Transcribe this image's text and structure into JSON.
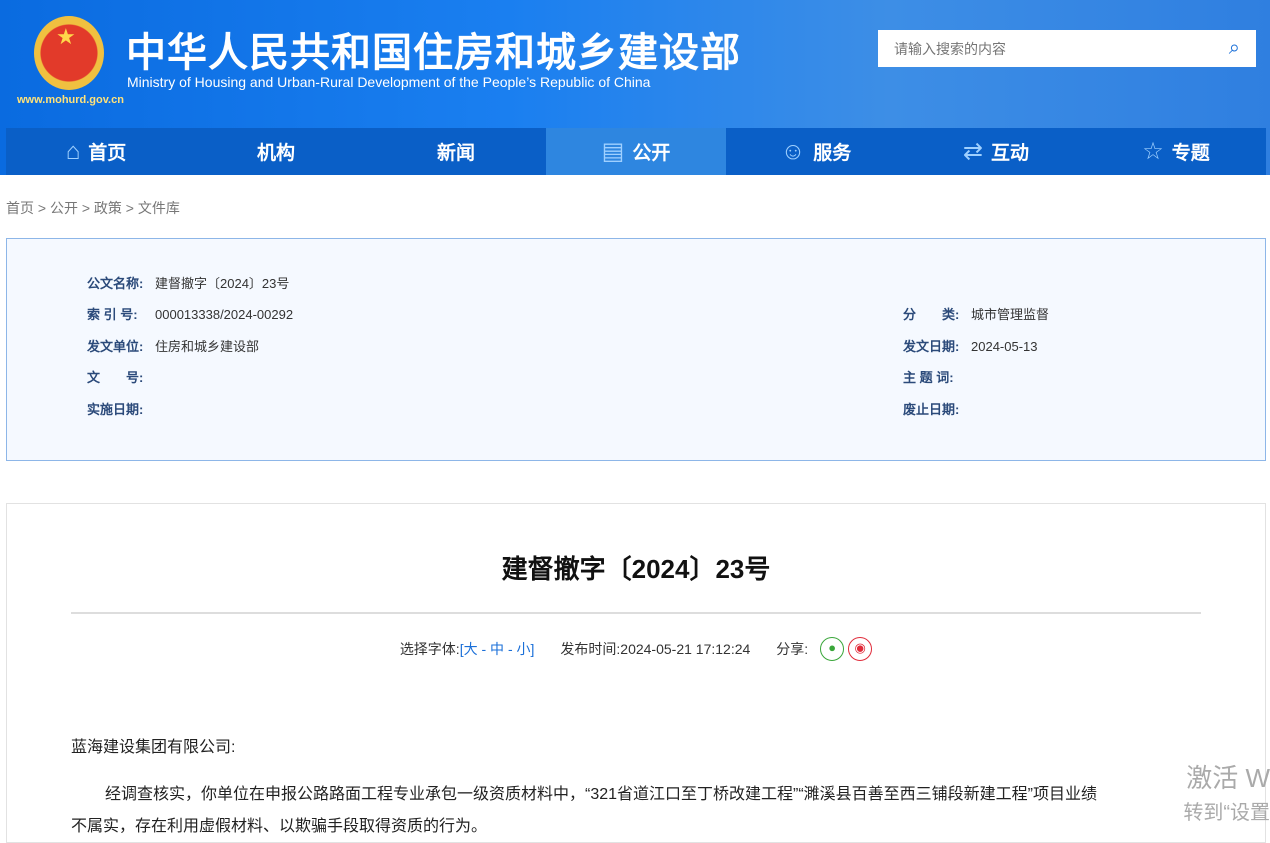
{
  "header": {
    "title_cn": "中华人民共和国住房和城乡建设部",
    "title_en": "Ministry of Housing and Urban-Rural Development of the People’s Republic of China",
    "url": "www.mohurd.gov.cn",
    "search_placeholder": "请输入搜索的内容"
  },
  "nav": [
    {
      "label": "首页",
      "icon": "home-icon"
    },
    {
      "label": "机构"
    },
    {
      "label": "新闻"
    },
    {
      "label": "公开",
      "icon": "document-icon",
      "active": true
    },
    {
      "label": "服务",
      "icon": "user-service-icon"
    },
    {
      "label": "互动",
      "icon": "interaction-icon"
    },
    {
      "label": "专题",
      "icon": "star-icon"
    }
  ],
  "breadcrumb": "首页 > 公开 > 政策 > 文件库",
  "meta": {
    "name_label": "公文名称:",
    "name": "建督撤字〔2024〕23号",
    "index_label": "索 引 号:",
    "index": "000013338/2024-00292",
    "category_label": "分　　类:",
    "category": "城市管理监督",
    "issuer_label": "发文单位:",
    "issuer": "住房和城乡建设部",
    "date_label": "发文日期:",
    "date": "2024-05-13",
    "docno_label": "文　　号:",
    "docno": "",
    "keywords_label": "主 题 词:",
    "keywords": "",
    "effective_label": "实施日期:",
    "effective": "",
    "expire_label": "废止日期:",
    "expire": ""
  },
  "article": {
    "title": "建督撤字〔2024〕23号",
    "font_label": "选择字体:",
    "font_open": "[",
    "font_large": "大",
    "font_mid": "中",
    "font_small": "小",
    "font_close": "]",
    "sep": "-",
    "publish_label": "发布时间:",
    "publish_time": "2024-05-21 17:12:24",
    "share_label": "分享:",
    "salutation": "蓝海建设集团有限公司:",
    "para1_line1": "经调查核实，你单位在申报公路路面工程专业承包一级资质材料中，“321省道江口至丁桥改建工程”“濉溪县百善至西三铺段新建工程”项目业绩",
    "para1_line2": "不属实，存在利用虚假材料、以欺骗手段取得资质的行为。"
  },
  "watermark": {
    "line1": "激活 W",
    "line2": "转到“设置"
  }
}
